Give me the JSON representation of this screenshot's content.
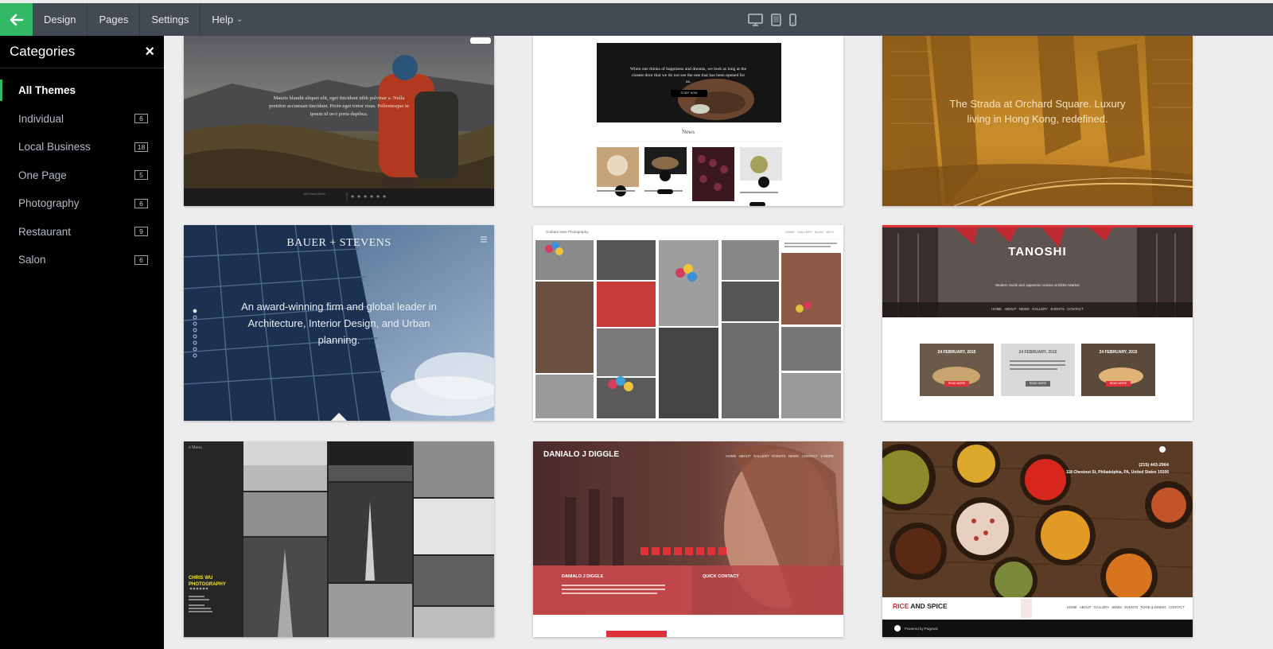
{
  "topbar": {
    "nav": [
      {
        "label": "Design"
      },
      {
        "label": "Pages"
      },
      {
        "label": "Settings"
      },
      {
        "label": "Help"
      }
    ],
    "back_icon": "arrow-left-icon",
    "devices": [
      "desktop-icon",
      "tablet-icon",
      "mobile-icon"
    ],
    "accent": "#33b866"
  },
  "sidebar": {
    "title": "Categories",
    "close": "×",
    "items": [
      {
        "label": "All Themes",
        "count": ""
      },
      {
        "label": "Individual",
        "count": "6"
      },
      {
        "label": "Local Business",
        "count": "18"
      },
      {
        "label": "One Page",
        "count": "5"
      },
      {
        "label": "Photography",
        "count": "6"
      },
      {
        "label": "Restaurant",
        "count": "9"
      },
      {
        "label": "Salon",
        "count": "6"
      }
    ]
  },
  "themes": {
    "t1": {
      "text": "Mauris blandit aliquet elit, eget tincidunt nibh pulvinar a. Nulla porttitor accumsan tincidunt. Proin eget tortor risus. Pellentesque in ipsum id orci porta dapibus."
    },
    "t2": {
      "hero": "When one thinks of happiness and dreams, we look as long at the closest door that we do not see the one that has been opened for us.",
      "cta": "START NOW",
      "news": "News"
    },
    "t3": {
      "text1": "The Strada at Orchard Square. Luxury",
      "text2": "living in Hong Kong, redefined."
    },
    "t4": {
      "title": "BAUER + STEVENS",
      "text1": "An award-winning firm and global leader in",
      "text2": "Architecture, Interior Design, and Urban",
      "text3": "planning."
    },
    "t5": {
      "title": "Crabara lowe Photography",
      "nav": "HOME   GALLERY   BLOG   INFO"
    },
    "t6": {
      "title": "TANOSHI",
      "subtitle": "Modern Sushi and Japanese cuisine at Elden Market",
      "nav": "HOME   ABOUT   NEWS   GALLERY   EVENTS   CONTACT",
      "date": "24 FEBRUARY, 2015",
      "btn": "READ MORE"
    },
    "t7": {
      "menu": "≡ Menu",
      "title1": "CHRIS WU",
      "title2": "PHOTOGRAPHY"
    },
    "t8": {
      "title": "DANIALO J DIGGLE",
      "nav": "HOME   ABOUT   GALLERY   EVENTS   NEWS   CONTACT   ≡ MORE",
      "about": "DANIALO J DIGGLE",
      "contact": "QUICK CONTACT"
    },
    "t9": {
      "phone": "(215) 443-2964",
      "address": "118 Chestnut St, Philadelphia, PA, United States 19106",
      "brand1": "RICE",
      "brand2": " AND SPICE",
      "nav": "HOME   ABOUT   GALLERY   NEWS   EVENTS   FOOD & DINING   CONTACT",
      "footer": "Powered by Pagewiz"
    }
  }
}
